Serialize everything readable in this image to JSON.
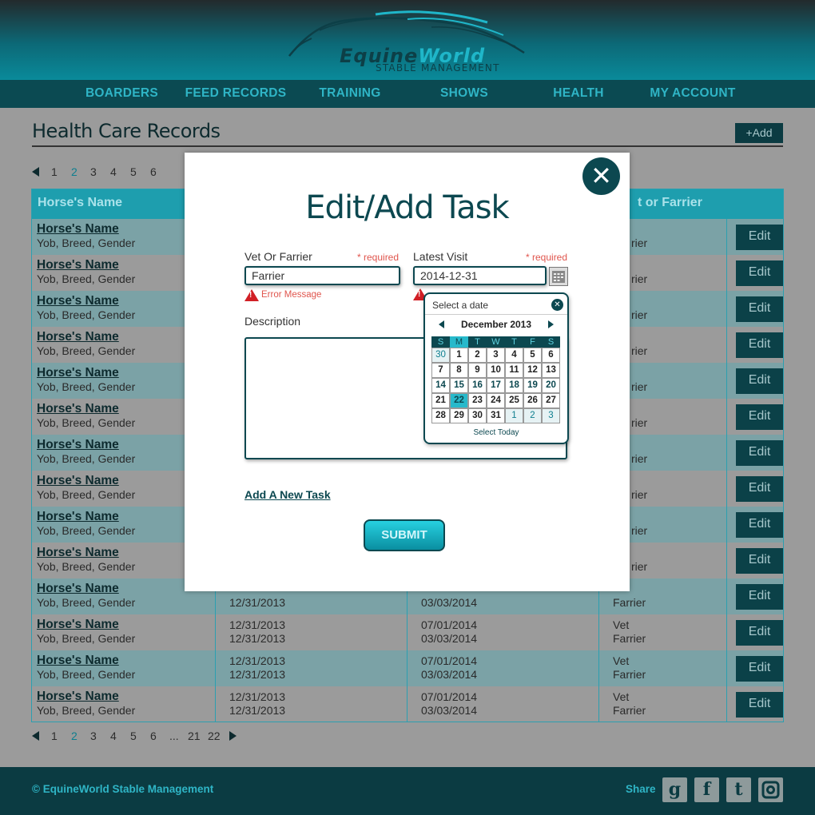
{
  "brand": {
    "name_part1": "Equine",
    "name_part2": "World",
    "tagline": "STABLE MANAGEMENT"
  },
  "nav": [
    "BOARDERS",
    "FEED RECORDS",
    "TRAINING",
    "SHOWS",
    "HEALTH",
    "MY ACCOUNT"
  ],
  "page": {
    "title": "Health Care Records",
    "add_label": "+Add"
  },
  "pager_top": [
    "1",
    "2",
    "3",
    "4",
    "5",
    "6"
  ],
  "pager_bottom": [
    "1",
    "2",
    "3",
    "4",
    "5",
    "6",
    "...",
    "21",
    "22"
  ],
  "table": {
    "headers": [
      "Horse's Name",
      "t or Farrier"
    ],
    "row_name": "Horse's Name",
    "row_sub": "Yob, Breed, Gender",
    "edit_label": "Edit",
    "visible_rows": [
      {
        "c4": "rier"
      },
      {
        "c4": "rier"
      },
      {
        "c4": "rier"
      },
      {
        "c4": "rier"
      },
      {
        "c4": "rier"
      },
      {
        "c4": "rier"
      },
      {
        "c4": "rier"
      },
      {
        "c4": "rier"
      },
      {
        "c4": "rier"
      },
      {
        "c4": "rier"
      },
      {
        "c2a": "",
        "c2b": "12/31/2013",
        "c3a": "",
        "c3b": "03/03/2014",
        "c4a": "",
        "c4b": "Farrier"
      },
      {
        "c2a": "12/31/2013",
        "c2b": "12/31/2013",
        "c3a": "07/01/2014",
        "c3b": "03/03/2014",
        "c4a": "Vet",
        "c4b": "Farrier"
      },
      {
        "c2a": "12/31/2013",
        "c2b": "12/31/2013",
        "c3a": "07/01/2014",
        "c3b": "03/03/2014",
        "c4a": "Vet",
        "c4b": "Farrier"
      },
      {
        "c2a": "12/31/2013",
        "c2b": "12/31/2013",
        "c3a": "07/01/2014",
        "c3b": "03/03/2014",
        "c4a": "Vet",
        "c4b": "Farrier"
      }
    ]
  },
  "modal": {
    "title": "Edit/Add Task",
    "vet_label": "Vet Or Farrier",
    "required": "* required",
    "vet_value": "Farrier",
    "error": "Error Message",
    "visit_label": "Latest Visit",
    "visit_value": "2014-12-31",
    "description_label": "Description",
    "add_task": "Add A New Task",
    "submit": "SUBMIT"
  },
  "calendar": {
    "header": "Select a date",
    "month": "December 2013",
    "dow": [
      "S",
      "M",
      "T",
      "W",
      "T",
      "F",
      "S"
    ],
    "weeks": [
      [
        "30",
        "1",
        "2",
        "3",
        "4",
        "5",
        "6"
      ],
      [
        "7",
        "8",
        "9",
        "10",
        "11",
        "12",
        "13"
      ],
      [
        "14",
        "15",
        "16",
        "17",
        "18",
        "19",
        "20"
      ],
      [
        "21",
        "22",
        "23",
        "24",
        "25",
        "26",
        "27"
      ],
      [
        "28",
        "29",
        "30",
        "31",
        "1",
        "2",
        "3"
      ]
    ],
    "selected": "22",
    "today_label": "Select Today"
  },
  "footer": {
    "copyright": "© EquineWorld Stable Management",
    "share": "Share"
  },
  "colors": {
    "accent": "#1e9eae",
    "dark": "#0b3b42",
    "error": "#e0554d"
  }
}
